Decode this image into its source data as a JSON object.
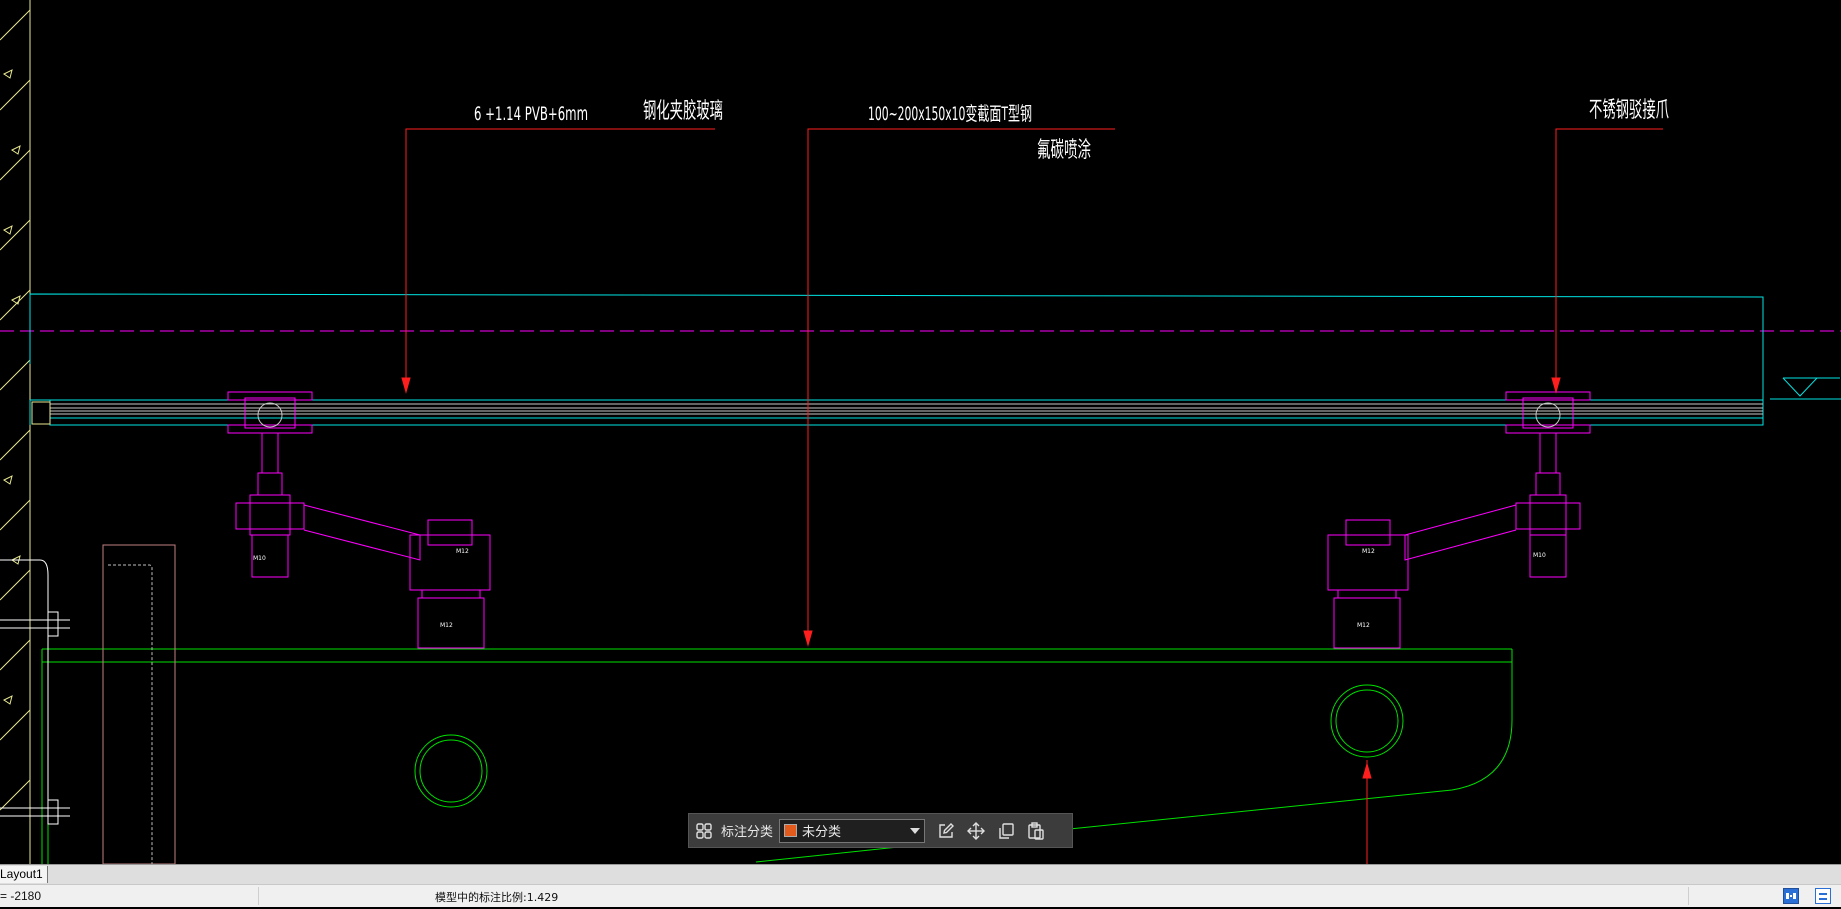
{
  "drawing": {
    "annotations": {
      "glass_spec": "6 +1.14 PVB+6mm",
      "glass_name": "钢化夹胶玻璃",
      "beam_spec": "100~200x150x10变截面T型钢",
      "beam_finish": "氟碳喷涂",
      "claw_name": "不锈钢驳接爪"
    },
    "tiny_labels": [
      "M10",
      "M12",
      "M12",
      "M10",
      "M12",
      "M12"
    ],
    "colors": {
      "background": "#000000",
      "leader": "#ff1e1e",
      "glass": "#00e5e5",
      "fitting": "#ff00ff",
      "structure": "#00e000",
      "wall": "#e8e890",
      "column": "#c08080",
      "centerline": "#ff00ff",
      "text": "#ffffff"
    }
  },
  "toolbar": {
    "grid_icon": "grid-icon",
    "label": "标注分类",
    "select_value": "未分类",
    "select_color": "#e25a1c",
    "tools": [
      "edit-icon",
      "move-icon",
      "copy-icon",
      "paste-icon"
    ]
  },
  "tabs": [
    {
      "label": "Layout1"
    }
  ],
  "status": {
    "coordinate": "= -2180",
    "scale_text": "模型中的标注比例:1.429"
  }
}
